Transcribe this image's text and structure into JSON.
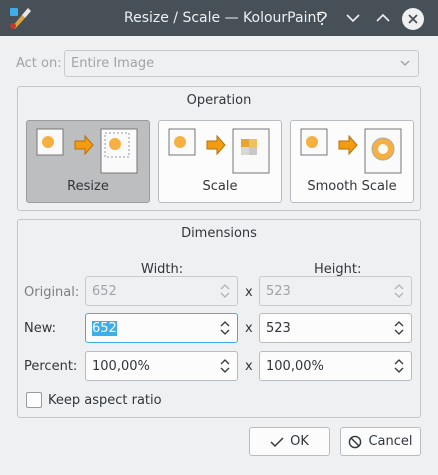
{
  "window": {
    "title": "Resize / Scale — KolourPaint"
  },
  "act_on": {
    "label": "Act on:",
    "value": "Entire Image"
  },
  "operation": {
    "title": "Operation",
    "options": [
      {
        "label": "Resize",
        "selected": true
      },
      {
        "label": "Scale",
        "selected": false
      },
      {
        "label": "Smooth Scale",
        "selected": false
      }
    ]
  },
  "dimensions": {
    "title": "Dimensions",
    "width_header": "Width:",
    "height_header": "Height:",
    "separator": "x",
    "rows": {
      "original": {
        "label": "Original:",
        "width": "652",
        "height": "523"
      },
      "new": {
        "label": "New:",
        "width": "652",
        "height": "523"
      },
      "percent": {
        "label": "Percent:",
        "width": "100,00%",
        "height": "100,00%"
      }
    }
  },
  "keep_aspect": {
    "label": "Keep aspect ratio",
    "checked": false
  },
  "buttons": {
    "ok": "OK",
    "cancel": "Cancel"
  },
  "colors": {
    "titlebar": "#475057",
    "accent": "#3daee9",
    "background": "#eff0f1"
  }
}
